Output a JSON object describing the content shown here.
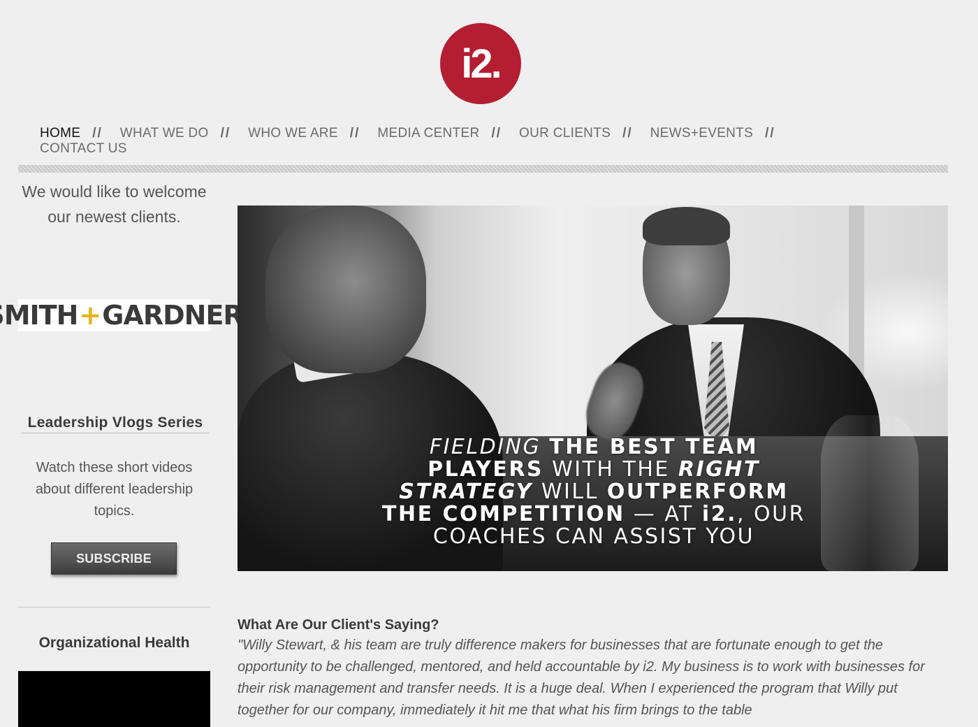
{
  "brand": {
    "logo_text": "i2.",
    "logo_color": "#b41e32"
  },
  "nav": {
    "items": [
      {
        "label": "HOME",
        "active": true
      },
      {
        "label": "WHAT WE DO"
      },
      {
        "label": "WHO WE ARE"
      },
      {
        "label": "MEDIA CENTER"
      },
      {
        "label": "OUR CLIENTS"
      },
      {
        "label": "NEWS+EVENTS"
      },
      {
        "label": "CONTACT US"
      }
    ],
    "separator": "//"
  },
  "sidebar": {
    "welcome_text": "We would like to welcome our newest clients.",
    "client_logo": {
      "left": "SMITH",
      "plus": "+",
      "right": "GARDNER",
      "accent_color": "#e8b41a"
    },
    "vlog": {
      "title": "Leadership Vlogs Series",
      "description": "Watch these short videos about different leadership topics.",
      "subscribe_label": "SUBSCRIBE"
    },
    "org_health_title": "Organizational Health"
  },
  "hero": {
    "caption_lines": [
      [
        {
          "t": "FIELDING ",
          "s": "thin it"
        },
        {
          "t": "THE BEST TEAM",
          "s": "bold"
        }
      ],
      [
        {
          "t": "PLAYERS",
          "s": "bold"
        },
        {
          "t": " WITH THE ",
          "s": "thin"
        },
        {
          "t": "RIGHT",
          "s": "bold it"
        }
      ],
      [
        {
          "t": "STRATEGY",
          "s": "bold it"
        },
        {
          "t": " WILL ",
          "s": "thin"
        },
        {
          "t": "OUTPERFORM",
          "s": "bold"
        }
      ],
      [
        {
          "t": "THE COMPETITION",
          "s": "bold"
        },
        {
          "t": " — AT ",
          "s": "thin"
        },
        {
          "t": "i2.",
          "s": "bold"
        },
        {
          "t": ", OUR",
          "s": "thin"
        }
      ],
      [
        {
          "t": "COACHES CAN ASSIST YOU",
          "s": "thin"
        }
      ]
    ]
  },
  "testimonial": {
    "heading": "What Are Our Client's Saying?",
    "body": "\"Willy Stewart, & his team are truly difference makers for businesses that are fortunate enough to get the opportunity to be challenged, mentored, and  held accountable by i2.  My business is to work with businesses for their risk management and transfer needs.  It is a huge deal.  When I experienced the program that Willy put together for our company, immediately it hit me that what his firm brings to the table"
  }
}
